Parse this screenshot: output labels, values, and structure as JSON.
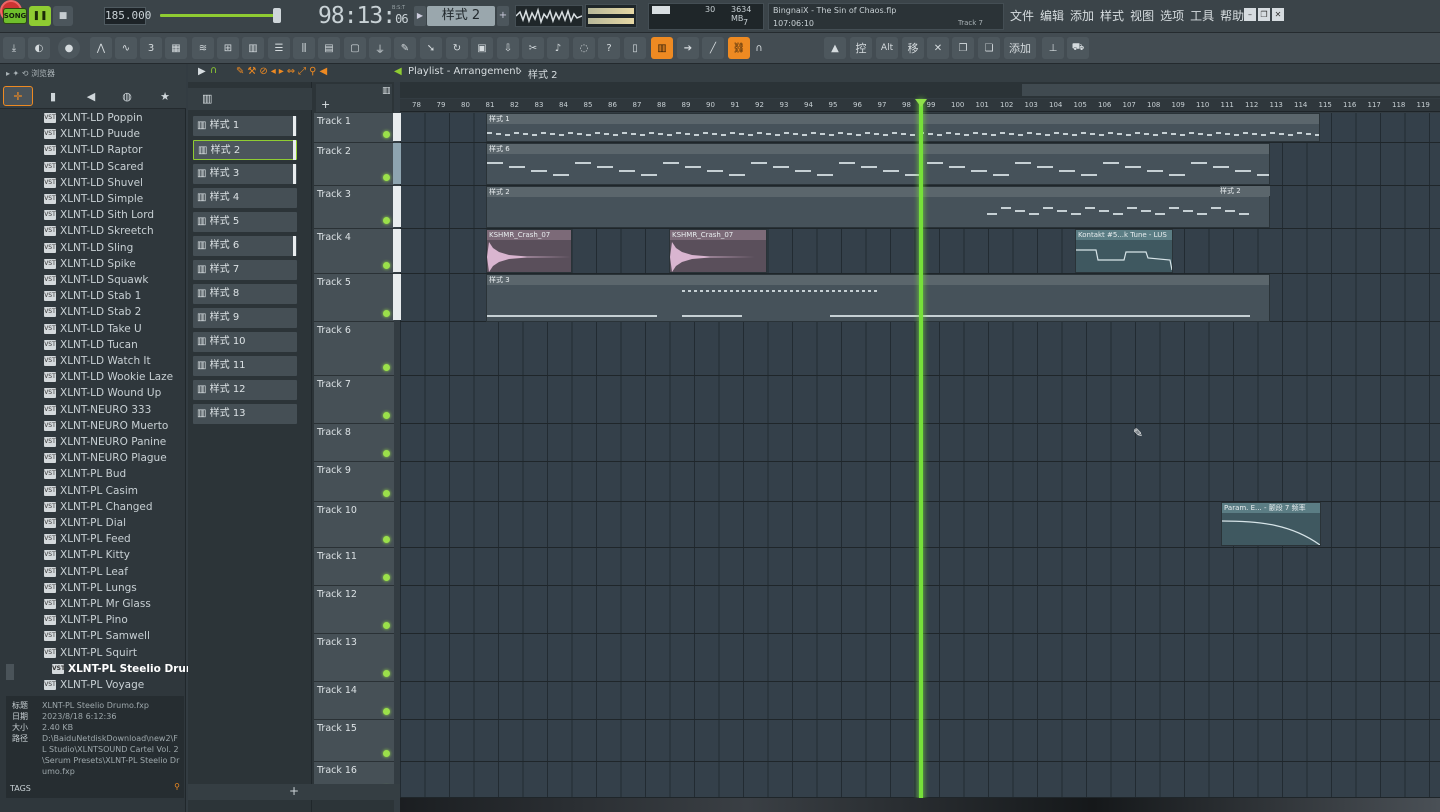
{
  "transport": {
    "song_label": "SONG",
    "tempo": "185.000",
    "time_main": "98:13:",
    "time_sub": "06",
    "time_unit": "B:S:T",
    "pattern_selected": "样式 2",
    "cpu_value": "30",
    "mem_value": "3634 MB",
    "poly_value": "7"
  },
  "hint_panel": {
    "title": "BingnaiX - The Sin of Chaos.flp",
    "time": "107:06:10",
    "track": "Track 7"
  },
  "menu": [
    "文件",
    "编辑",
    "添加",
    "样式",
    "视图",
    "选项",
    "工具",
    "帮助"
  ],
  "toolbar": {
    "snap_value": "线",
    "labels": {
      "ctrl": "控",
      "alt": "Alt",
      "move": "移",
      "add": "添加"
    }
  },
  "browser": {
    "header": "浏览器",
    "items": [
      "XLNT-LD Poppin",
      "XLNT-LD Puude",
      "XLNT-LD Raptor",
      "XLNT-LD Scared",
      "XLNT-LD Shuvel",
      "XLNT-LD Simple",
      "XLNT-LD Sith Lord",
      "XLNT-LD Skreetch",
      "XLNT-LD Sling",
      "XLNT-LD Spike",
      "XLNT-LD Squawk",
      "XLNT-LD Stab 1",
      "XLNT-LD Stab 2",
      "XLNT-LD Take U",
      "XLNT-LD Tucan",
      "XLNT-LD Watch It",
      "XLNT-LD Wookie Laze",
      "XLNT-LD Wound Up",
      "XLNT-NEURO 333",
      "XLNT-NEURO Muerto",
      "XLNT-NEURO Panine",
      "XLNT-NEURO Plague",
      "XLNT-PL Bud",
      "XLNT-PL Casim",
      "XLNT-PL Changed",
      "XLNT-PL Dial",
      "XLNT-PL Feed",
      "XLNT-PL Kitty",
      "XLNT-PL Leaf",
      "XLNT-PL Lungs",
      "XLNT-PL Mr Glass",
      "XLNT-PL Pino",
      "XLNT-PL Samwell",
      "XLNT-PL Squirt",
      "XLNT-PL Steelio Drumo",
      "XLNT-PL Voyage"
    ],
    "selected_index": 34,
    "info": {
      "labels": [
        "标题",
        "日期",
        "大小",
        "路径"
      ],
      "title": "XLNT-PL Steelio Drumo.fxp",
      "date": "2023/8/18 6:12:36",
      "size": "2.40 KB",
      "path": "D:\\BaiduNetdiskDownload\\new2\\FL Studio\\XLNTSOUND Cartel Vol. 2\\Serum Presets\\XLNT-PL Steelio Drumo.fxp"
    },
    "tags_label": "TAGS"
  },
  "patterns": [
    "样式 1",
    "样式 2",
    "样式 3",
    "样式 4",
    "样式 5",
    "样式 6",
    "样式 7",
    "样式 8",
    "样式 9",
    "样式 10",
    "样式 11",
    "样式 12",
    "样式 13"
  ],
  "playlist": {
    "title": "Playlist - Arrangement",
    "breadcrumb_pattern": "样式 2",
    "ruler": [
      "78",
      "79",
      "80",
      "81",
      "82",
      "83",
      "84",
      "85",
      "86",
      "87",
      "88",
      "89",
      "90",
      "91",
      "92",
      "93",
      "94",
      "95",
      "96",
      "97",
      "98",
      "99",
      "100",
      "101",
      "102",
      "103",
      "104",
      "105",
      "106",
      "107",
      "108",
      "109",
      "110",
      "111",
      "112",
      "113",
      "114",
      "115",
      "116",
      "117",
      "118",
      "119"
    ],
    "tracks": [
      "Track 1",
      "Track 2",
      "Track 3",
      "Track 4",
      "Track 5",
      "Track 6",
      "Track 7",
      "Track 8",
      "Track 9",
      "Track 10",
      "Track 11",
      "Track 12",
      "Track 13",
      "Track 14",
      "Track 15",
      "Track 16"
    ],
    "clips": {
      "c1": "样式 1",
      "c2": "样式 6",
      "c3": "样式 2",
      "c3b": "样式 2",
      "c4a": "KSHMR_Crash_07",
      "c4b": "KSHMR_Crash_07",
      "c4c": "Kontakt #5...k Tune - LUS",
      "c5": "样式 3",
      "c10": "Param. E... - 颤段 7 频率"
    }
  }
}
